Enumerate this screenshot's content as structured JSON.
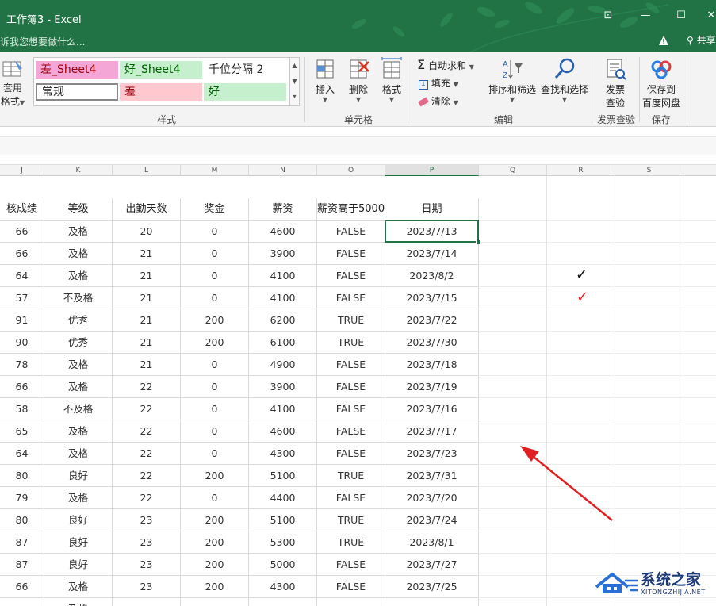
{
  "window": {
    "title": "工作簿3 - Excel",
    "tell_me": "诉我您想要做什么...",
    "share": "共享"
  },
  "ribbon": {
    "format_as_table_line1": "套用",
    "format_as_table_line2": "格式",
    "styles": [
      {
        "label": "差_Sheet4",
        "bg": "#f4a6d7",
        "color": "#9c0006"
      },
      {
        "label": "好_Sheet4",
        "bg": "#c6efce",
        "color": "#006100"
      },
      {
        "label": "千位分隔 2",
        "bg": "#ffffff",
        "color": "#222222"
      },
      {
        "label": "常规",
        "bg": "#ffffff",
        "color": "#222222"
      },
      {
        "label": "差",
        "bg": "#ffc7ce",
        "color": "#9c0006"
      },
      {
        "label": "好",
        "bg": "#c6efce",
        "color": "#006100"
      }
    ],
    "group_styles": "样式",
    "insert": "插入",
    "delete": "删除",
    "format": "格式",
    "group_cells": "单元格",
    "autosum": "自动求和",
    "fill": "填充",
    "clear": "清除",
    "sort_filter": "排序和筛选",
    "find_select": "查找和选择",
    "group_edit": "编辑",
    "invoice_line1": "发票",
    "invoice_line2": "查验",
    "group_invoice": "发票查验",
    "save_line1": "保存到",
    "save_line2": "百度网盘",
    "group_save": "保存"
  },
  "columns": [
    "J",
    "K",
    "L",
    "M",
    "N",
    "O",
    "P",
    "Q",
    "R",
    "S"
  ],
  "headers": [
    "核成绩",
    "等级",
    "出勤天数",
    "奖金",
    "薪资",
    "薪资高于5000",
    "日期"
  ],
  "rows": [
    [
      "66",
      "及格",
      "20",
      "0",
      "4600",
      "FALSE",
      "2023/7/13"
    ],
    [
      "66",
      "及格",
      "21",
      "0",
      "3900",
      "FALSE",
      "2023/7/14"
    ],
    [
      "64",
      "及格",
      "21",
      "0",
      "4100",
      "FALSE",
      "2023/8/2"
    ],
    [
      "57",
      "不及格",
      "21",
      "0",
      "4100",
      "FALSE",
      "2023/7/15"
    ],
    [
      "91",
      "优秀",
      "21",
      "200",
      "6200",
      "TRUE",
      "2023/7/22"
    ],
    [
      "90",
      "优秀",
      "21",
      "200",
      "6100",
      "TRUE",
      "2023/7/30"
    ],
    [
      "78",
      "及格",
      "21",
      "0",
      "4900",
      "FALSE",
      "2023/7/18"
    ],
    [
      "66",
      "及格",
      "22",
      "0",
      "3900",
      "FALSE",
      "2023/7/19"
    ],
    [
      "58",
      "不及格",
      "22",
      "0",
      "4100",
      "FALSE",
      "2023/7/16"
    ],
    [
      "65",
      "及格",
      "22",
      "0",
      "4600",
      "FALSE",
      "2023/7/17"
    ],
    [
      "64",
      "及格",
      "22",
      "0",
      "4300",
      "FALSE",
      "2023/7/23"
    ],
    [
      "80",
      "良好",
      "22",
      "200",
      "5100",
      "TRUE",
      "2023/7/31"
    ],
    [
      "79",
      "及格",
      "22",
      "0",
      "4400",
      "FALSE",
      "2023/7/20"
    ],
    [
      "80",
      "良好",
      "23",
      "200",
      "5100",
      "TRUE",
      "2023/7/24"
    ],
    [
      "87",
      "良好",
      "23",
      "200",
      "5300",
      "TRUE",
      "2023/8/1"
    ],
    [
      "87",
      "良好",
      "23",
      "200",
      "5000",
      "FALSE",
      "2023/7/27"
    ],
    [
      "66",
      "及格",
      "23",
      "200",
      "4300",
      "FALSE",
      "2023/7/25"
    ],
    [
      "",
      "及格",
      "",
      "",
      "",
      "",
      ""
    ]
  ],
  "marks": {
    "black_check": "✓",
    "red_check": "✓"
  },
  "watermark": {
    "title": "系统之家",
    "subtitle": "XITONGZHIJIA.NET"
  },
  "colors": {
    "excel_green": "#217346",
    "arrow_red": "#e02020"
  }
}
